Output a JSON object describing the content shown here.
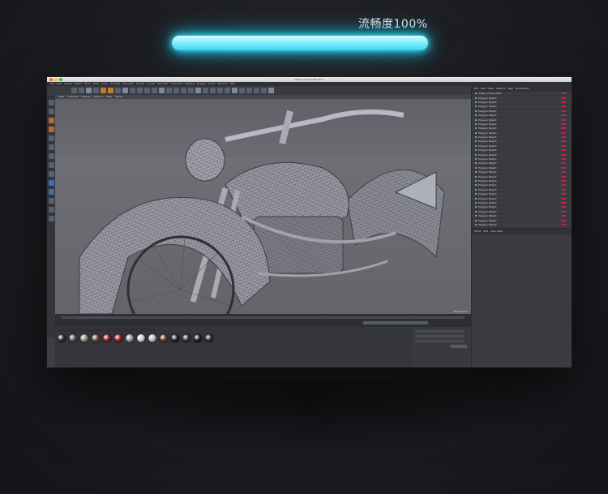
{
  "fluency": {
    "label": "流畅度100%",
    "percent": 100,
    "color": "#39d9f5"
  },
  "app": {
    "window_title": "Indian_Chief_1946.c4d *",
    "menu": [
      "File",
      "Edit",
      "Create",
      "Select",
      "Tools",
      "Mesh",
      "Snap",
      "Animate",
      "Simulate",
      "Render",
      "Sculpt",
      "MoGraph",
      "Character",
      "Pipeline",
      "Plugins",
      "Script",
      "Window",
      "Help"
    ],
    "viewport_menu": [
      "View",
      "Cameras",
      "Display",
      "Options",
      "Filter",
      "Panel"
    ],
    "viewport_status": "Perspective",
    "object_manager": {
      "tabs": [
        "File",
        "Edit",
        "View",
        "Objects",
        "Tags",
        "Bookmarks"
      ],
      "rows": [
        "Indian_Chief_1946",
        "Polygon Object",
        "Polygon Object",
        "Polygon Object",
        "Polygon Object",
        "Polygon Object",
        "Polygon Object",
        "Polygon Object",
        "Polygon Object",
        "Polygon Object",
        "Polygon Object",
        "Polygon Object",
        "Polygon Object",
        "Polygon Object",
        "Polygon Object",
        "Polygon Object",
        "Polygon Object",
        "Polygon Object",
        "Polygon Object",
        "Polygon Object",
        "Polygon Object",
        "Polygon Object",
        "Polygon Object",
        "Polygon Object",
        "Polygon Object",
        "Polygon Object",
        "Polygon Object",
        "Polygon Object",
        "Polygon Object",
        "Polygon Object",
        "Polygon Object",
        "Polygon Object",
        "Polygon Object",
        "Polygon Object",
        "Polygon Object",
        "Polygon Object"
      ]
    },
    "attr_tabs": [
      "Mode",
      "Edit",
      "User Data"
    ],
    "materials": [
      "#2b2b2b",
      "#555",
      "#888",
      "#6a4a3a",
      "#8a1a1a",
      "#a01818",
      "#999",
      "#ccc",
      "#bbb",
      "#5a3a2a",
      "#222",
      "#303030",
      "#1b1b1b",
      "#2a2a2a"
    ]
  }
}
